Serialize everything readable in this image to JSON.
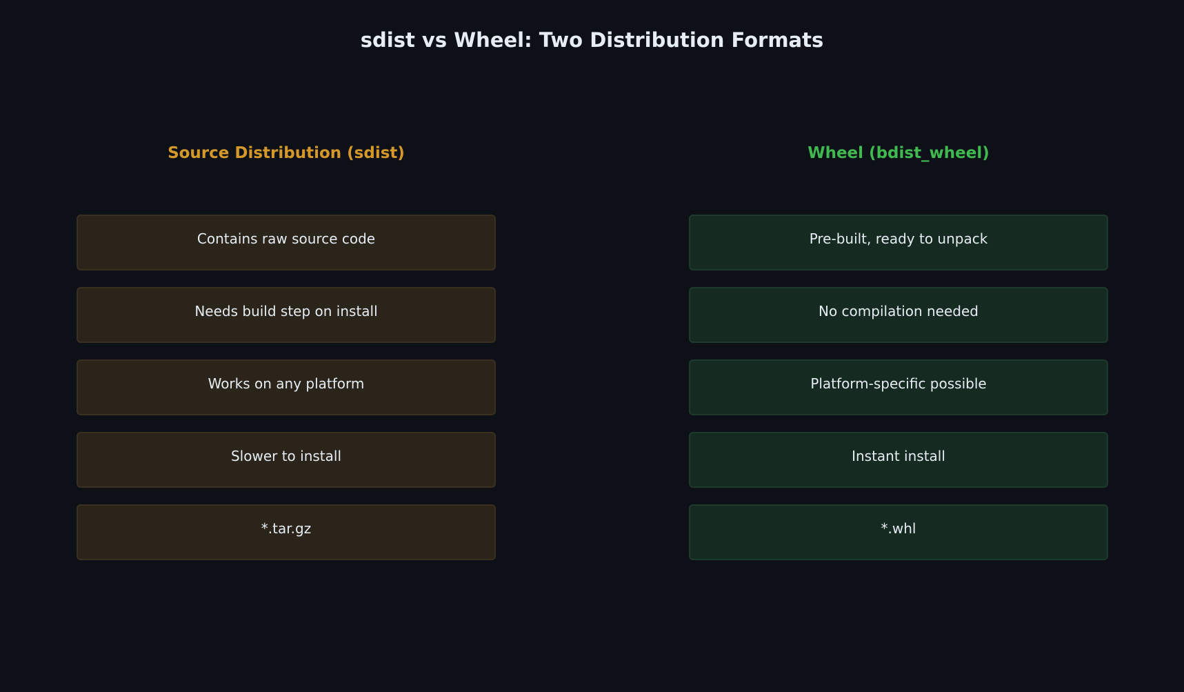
{
  "title": "sdist vs Wheel: Two Distribution Formats",
  "colors": {
    "background": "#0d1017",
    "sdist_accent": "#d4992a",
    "wheel_accent": "#3fb950",
    "sdist_card_bg": "#2b241a",
    "wheel_card_bg": "#152a21",
    "text": "#e6edf3"
  },
  "columns": [
    {
      "heading": "Source Distribution (sdist)",
      "items": [
        "Contains raw source code",
        "Needs build step on install",
        "Works on any platform",
        "Slower to install",
        "*.tar.gz"
      ]
    },
    {
      "heading": "Wheel (bdist_wheel)",
      "items": [
        "Pre-built, ready to unpack",
        "No compilation needed",
        "Platform-specific possible",
        "Instant install",
        "*.whl"
      ]
    }
  ]
}
